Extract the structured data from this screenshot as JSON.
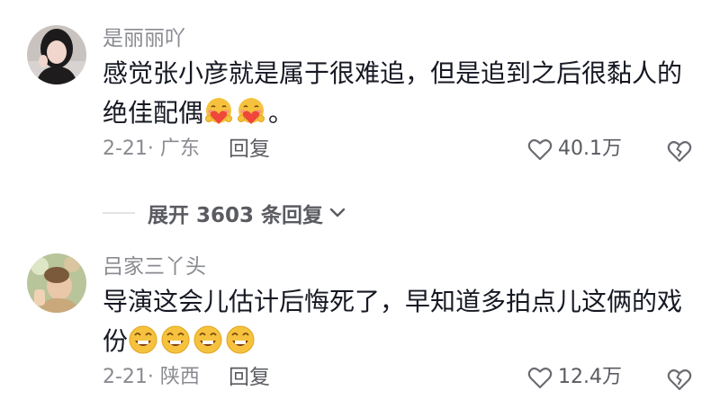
{
  "comments": [
    {
      "username": "是丽丽吖",
      "text": "感觉张小彦就是属于很难追，但是追到之后很黏人的绝佳配偶",
      "emojis": [
        "hug-heart-emoji",
        "hug-heart-emoji"
      ],
      "suffix": "。",
      "meta": "2-21· 广东",
      "reply_label": "回复",
      "likes": "40.1万"
    },
    {
      "username": "吕家三丫头",
      "text": "导演这会儿估计后悔死了，早知道多拍点儿这俩的戏份",
      "emojis": [
        "grin-emoji",
        "grin-emoji",
        "grin-emoji",
        "grin-emoji"
      ],
      "suffix": "",
      "meta": "2-21· 陕西",
      "reply_label": "回复",
      "likes": "12.4万"
    }
  ],
  "expand_replies": {
    "label": "展开 3603 条回复"
  },
  "colors": {
    "secondary": "#8a8b91",
    "primary": "#161823",
    "emoji_face": "#f6c23e",
    "heart": "#f0463c"
  }
}
